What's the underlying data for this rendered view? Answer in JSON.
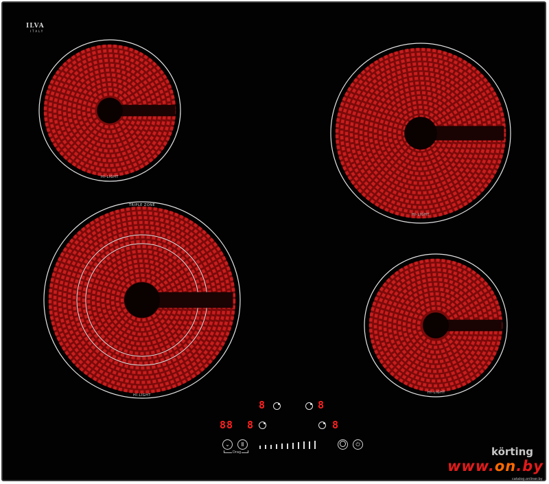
{
  "brand": {
    "name": "ILVA",
    "sub": "ITALY"
  },
  "zones": [
    {
      "id": "rear-left",
      "label": "HI-LIGHT",
      "rings": 1
    },
    {
      "id": "rear-right",
      "label": "HI-LIGHT",
      "rings": 1
    },
    {
      "id": "front-left",
      "label": "HI-LIGHT",
      "top_label": "TRIPLE ZONE",
      "rings": 3
    },
    {
      "id": "front-right",
      "label": "HI-LIGHT",
      "rings": 1
    }
  ],
  "controls": {
    "display_rear_left": "8",
    "display_rear_right": "8",
    "display_timer": "88",
    "display_front_left": "8",
    "display_front_right": "8",
    "drag_label": "Drag",
    "pause_symbol": "Ⅱ",
    "slider_steps": 11
  },
  "watermark": {
    "korting": "körting",
    "site_a": "www.",
    "site_b": "on",
    "site_c": ".by",
    "small": "catalog.onliner.by"
  },
  "colors": {
    "glass": "#020202",
    "coil": "#c81e1e",
    "coil_dark": "#7a0a0a",
    "display": "#ff2020",
    "line": "#e6e6e6"
  }
}
